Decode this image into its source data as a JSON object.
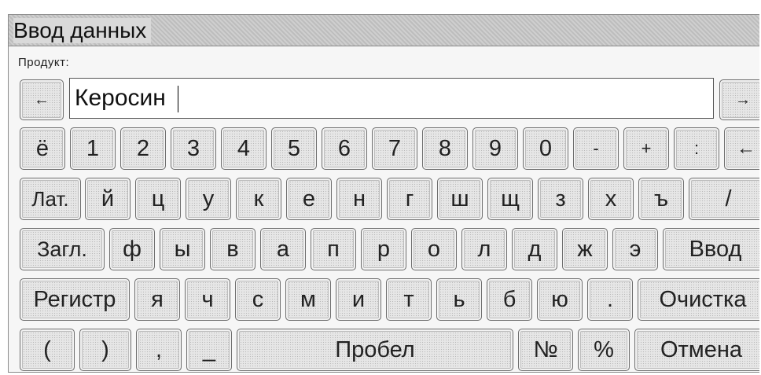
{
  "window": {
    "title": "Ввод данных",
    "field_label": "Продукт:",
    "input_value": "Керосин"
  },
  "nav": {
    "left_arrow": "←",
    "right_arrow": "→"
  },
  "keyboard": {
    "row1": [
      "ё",
      "1",
      "2",
      "3",
      "4",
      "5",
      "6",
      "7",
      "8",
      "9",
      "0",
      "-",
      "+",
      ":",
      "←"
    ],
    "row2": [
      "Лат.",
      "й",
      "ц",
      "у",
      "к",
      "е",
      "н",
      "г",
      "ш",
      "щ",
      "з",
      "х",
      "ъ",
      "/"
    ],
    "row3": [
      "Загл.",
      "ф",
      "ы",
      "в",
      "а",
      "п",
      "р",
      "о",
      "л",
      "д",
      "ж",
      "э",
      "Ввод"
    ],
    "row4": [
      "Регистр",
      "я",
      "ч",
      "с",
      "м",
      "и",
      "т",
      "ь",
      "б",
      "ю",
      ".",
      "Очистка"
    ],
    "row5": [
      "(",
      ")",
      ",",
      "_",
      "Пробел",
      "№",
      "%",
      "Отмена"
    ]
  }
}
